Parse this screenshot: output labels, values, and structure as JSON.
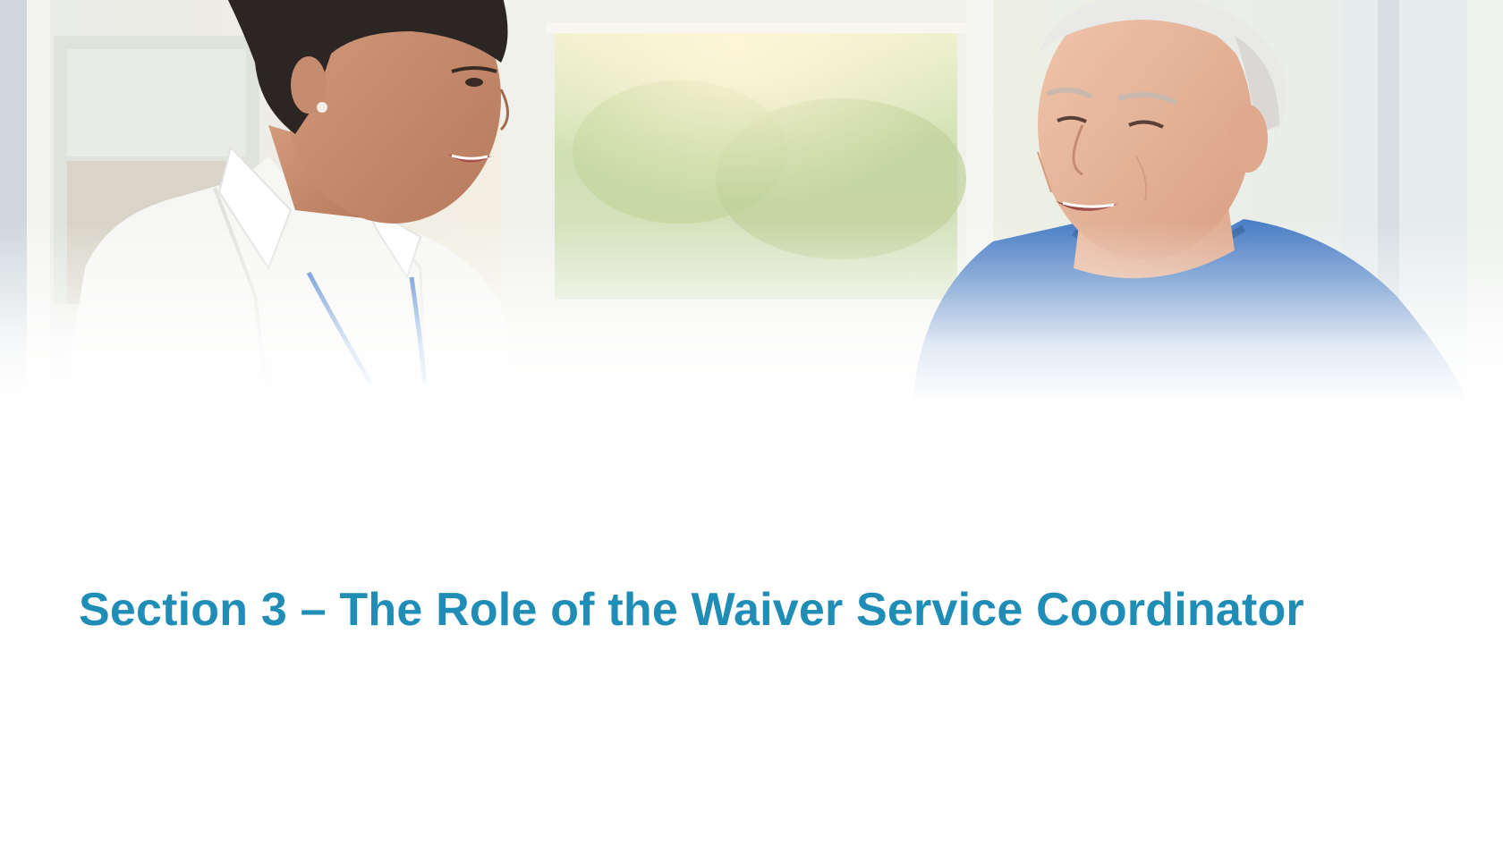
{
  "slide": {
    "title": "Section 3 – The Role of the Waiver Service Coordinator",
    "accent_color": "#1f8db5",
    "background_color": "#ffffff"
  },
  "hero_image": {
    "subject": "care coordinator talking with an older man by a sunny window",
    "people": [
      "woman in white shirt with lanyard",
      "older man in blue sweater"
    ]
  }
}
